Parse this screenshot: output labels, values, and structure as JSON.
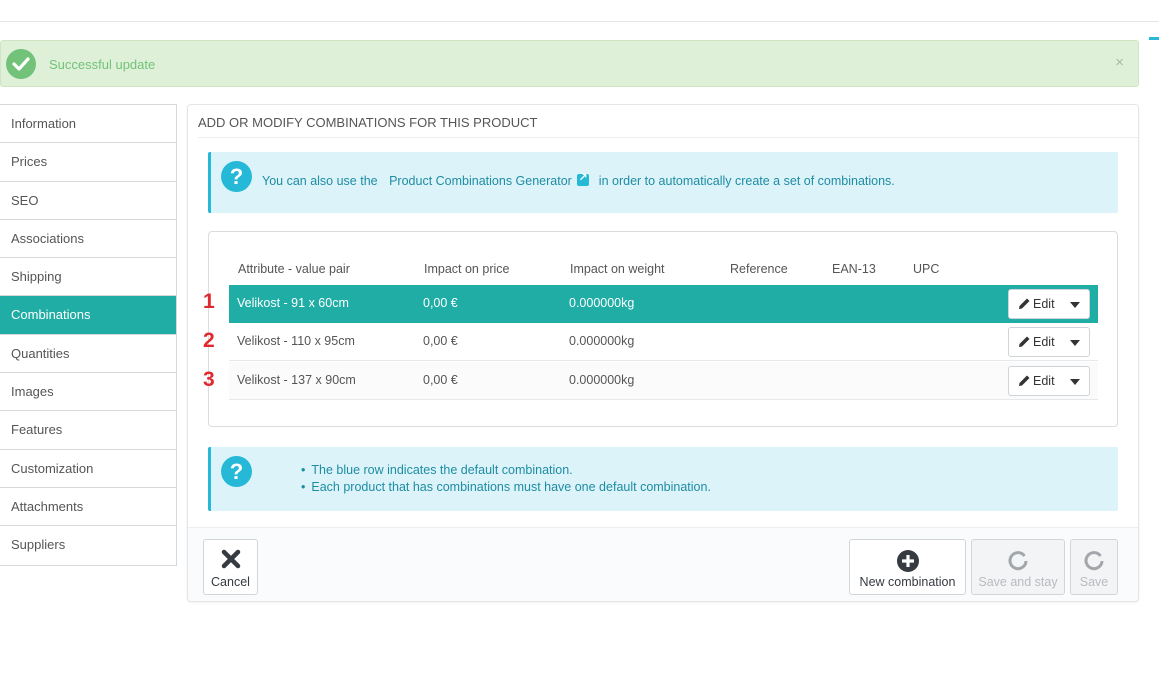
{
  "alert": {
    "message": "Successful update",
    "close": "×"
  },
  "sidebar": {
    "items": [
      {
        "label": "Information"
      },
      {
        "label": "Prices"
      },
      {
        "label": "SEO"
      },
      {
        "label": "Associations"
      },
      {
        "label": "Shipping"
      },
      {
        "label": "Combinations",
        "active": true
      },
      {
        "label": "Quantities"
      },
      {
        "label": "Images"
      },
      {
        "label": "Features"
      },
      {
        "label": "Customization"
      },
      {
        "label": "Attachments"
      },
      {
        "label": "Suppliers"
      }
    ]
  },
  "panel": {
    "heading": "ADD OR MODIFY COMBINATIONS FOR THIS PRODUCT",
    "info_top": {
      "prefix": "You can also use the",
      "link": "Product Combinations Generator",
      "suffix": "in order to automatically create a set of combinations."
    },
    "table": {
      "columns": [
        "Attribute - value pair",
        "Impact on price",
        "Impact on weight",
        "Reference",
        "EAN-13",
        "UPC"
      ],
      "rows": [
        {
          "marker": "1",
          "attribute": "Velikost - 91 x 60cm",
          "price": "0,00 €",
          "weight": "0.000000kg",
          "reference": "",
          "ean13": "",
          "upc": "",
          "default": true
        },
        {
          "marker": "2",
          "attribute": "Velikost - 110 x 95cm",
          "price": "0,00 €",
          "weight": "0.000000kg",
          "reference": "",
          "ean13": "",
          "upc": "",
          "default": false
        },
        {
          "marker": "3",
          "attribute": "Velikost - 137 x 90cm",
          "price": "0,00 €",
          "weight": "0.000000kg",
          "reference": "",
          "ean13": "",
          "upc": "",
          "default": false
        }
      ],
      "edit_label": "Edit"
    },
    "info_bottom": {
      "lines": [
        "The blue row indicates the default combination.",
        "Each product that has combinations must have one default combination."
      ]
    },
    "footer": {
      "cancel": "Cancel",
      "new_combination": "New combination",
      "save_and_stay": "Save and stay",
      "save": "Save"
    }
  },
  "colors": {
    "accent": "#1fada5",
    "info_bg": "#dcf4f9",
    "info_text": "#1e8ca3",
    "success_bg": "#dff0d8",
    "success_text": "#72c279",
    "marker_red": "#e1282e"
  }
}
